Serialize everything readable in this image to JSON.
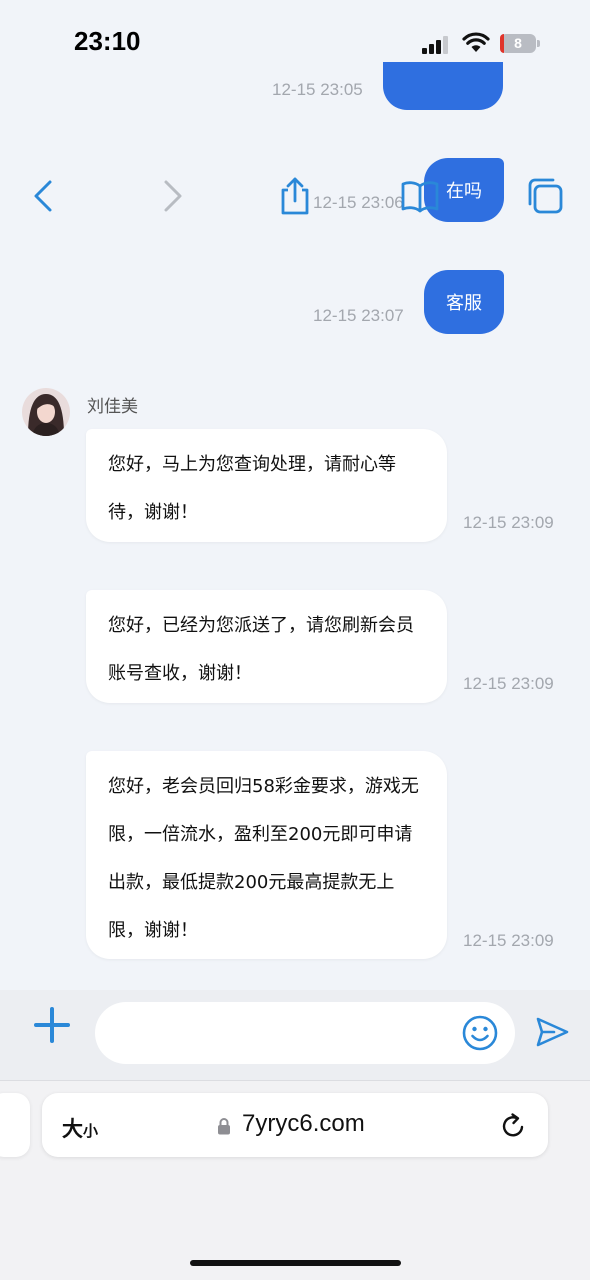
{
  "status_bar": {
    "time": "23:10",
    "battery": "8"
  },
  "chat": {
    "outgoing": [
      {
        "time": "12-15 23:05",
        "text": ""
      },
      {
        "time": "12-15 23:06",
        "text": "在吗"
      },
      {
        "time": "12-15 23:07",
        "text": "客服"
      }
    ],
    "sender_name": "刘佳美",
    "incoming": [
      {
        "time": "12-15 23:09",
        "text": "您好，马上为您查询处理，请耐心等待，谢谢！"
      },
      {
        "time": "12-15 23:09",
        "text": "您好，已经为您派送了，请您刷新会员账号查收，谢谢！"
      },
      {
        "time": "12-15 23:09",
        "text": "您好，老会员回归58彩金要求，游戏无限，一倍流水，盈利至200元即可申请出款，最低提款200元最高提款无上限，谢谢！"
      }
    ]
  },
  "input_bar": {
    "placeholder": "",
    "icons": [
      "plus-icon",
      "emoji-icon",
      "send-icon"
    ]
  },
  "browser": {
    "text_size_big": "大",
    "text_size_small": "小",
    "url": "7yryc6.com",
    "icons": [
      "lock-icon",
      "reload-icon",
      "back-icon",
      "forward-icon",
      "share-icon",
      "bookmarks-icon",
      "tabs-icon"
    ]
  },
  "colors": {
    "accent": "#2f6fe0",
    "icon_blue": "#2a88d8",
    "background": "#f1f4f9"
  }
}
